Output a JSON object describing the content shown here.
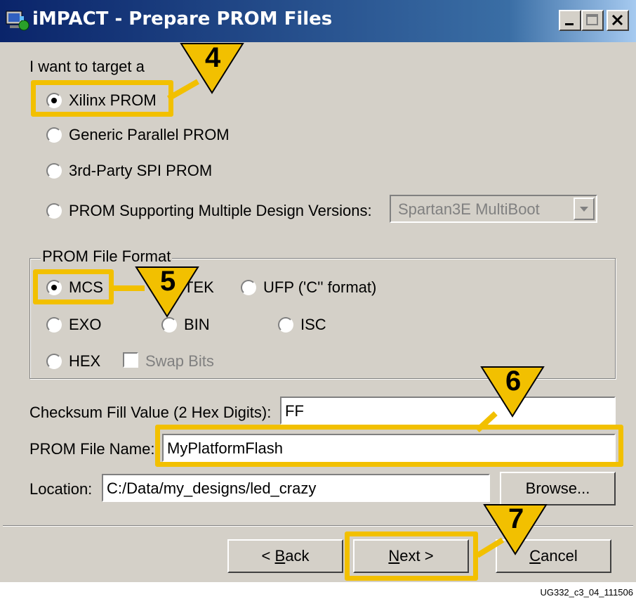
{
  "window": {
    "title": "iMPACT - Prepare PROM Files"
  },
  "target": {
    "heading": "I want to target a",
    "options": [
      {
        "label": "Xilinx PROM",
        "selected": true
      },
      {
        "label": "Generic Parallel PROM",
        "selected": false
      },
      {
        "label": "3rd-Party SPI PROM",
        "selected": false
      },
      {
        "label": "PROM Supporting Multiple Design Versions:",
        "selected": false
      }
    ],
    "multiboot_select": {
      "value": "Spartan3E MultiBoot",
      "enabled": false
    }
  },
  "format": {
    "group_title": "PROM File Format",
    "options": [
      {
        "label": "MCS",
        "selected": true
      },
      {
        "label": "TEK",
        "selected": false
      },
      {
        "label": "UFP ('C'' format)",
        "selected": false
      },
      {
        "label": "EXO",
        "selected": false
      },
      {
        "label": "BIN",
        "selected": false
      },
      {
        "label": "ISC",
        "selected": false
      },
      {
        "label": "HEX",
        "selected": false
      }
    ],
    "swap_bits": {
      "label": "Swap Bits",
      "checked": false,
      "enabled": false
    }
  },
  "fields": {
    "checksum_label": "Checksum Fill Value (2 Hex Digits):",
    "checksum_value": "FF",
    "filename_label": "PROM File Name:",
    "filename_value": "MyPlatformFlash",
    "location_label": "Location:",
    "location_value": "C:/Data/my_designs/led_crazy",
    "browse_label": "Browse..."
  },
  "buttons": {
    "back": {
      "prefix": "< ",
      "accel": "B",
      "rest": "ack"
    },
    "next": {
      "accel": "N",
      "rest": "ext >"
    },
    "cancel": {
      "accel": "C",
      "rest": "ancel"
    }
  },
  "callouts": [
    "4",
    "5",
    "6",
    "7"
  ],
  "figure_id": "UG332_c3_04_111506",
  "colors": {
    "highlight": "#f2c000",
    "titlebar": "#0a246a",
    "window_bg": "#d4d0c8"
  }
}
